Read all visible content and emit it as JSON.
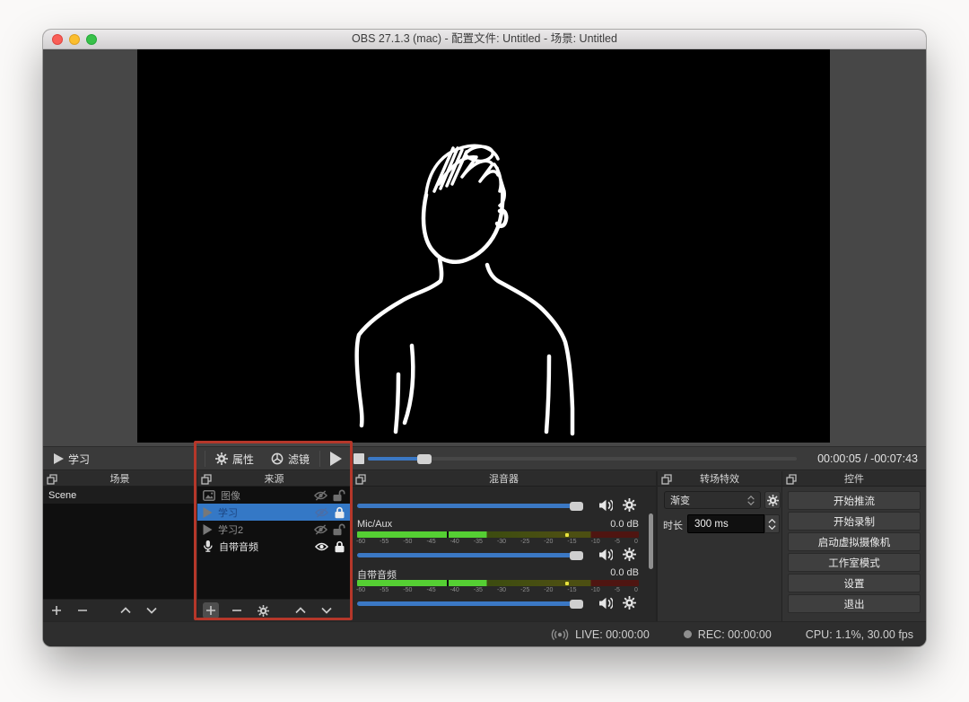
{
  "window": {
    "title": "OBS 27.1.3 (mac) - 配置文件: Untitled - 场景: Untitled"
  },
  "media_toolbar": {
    "source_name": "学习",
    "properties_label": "属性",
    "filters_label": "滤镜",
    "time": "00:00:05 / -00:07:43"
  },
  "scenes": {
    "title": "场景",
    "rows": [
      {
        "label": "Scene"
      }
    ]
  },
  "sources": {
    "title": "来源",
    "rows": [
      {
        "label": "图像"
      },
      {
        "label": "学习"
      },
      {
        "label": "学习2"
      },
      {
        "label": "自带音频"
      }
    ]
  },
  "mixer": {
    "title": "混音器",
    "channels": [
      {
        "name": "Mic/Aux",
        "level": "0.0 dB"
      },
      {
        "name": "自带音频",
        "level": "0.0 dB"
      }
    ],
    "scale_ticks": [
      "-60",
      "-55",
      "-50",
      "-45",
      "-40",
      "-35",
      "-30",
      "-25",
      "-20",
      "-15",
      "-10",
      "-5",
      "0"
    ]
  },
  "transitions": {
    "title": "转场特效",
    "selected_transition": "渐变",
    "duration_label": "时长",
    "duration_value": "300 ms"
  },
  "controls": {
    "title": "控件",
    "buttons": {
      "stream": "开始推流",
      "record": "开始录制",
      "virtual_cam": "启动虚拟摄像机",
      "studio_mode": "工作室模式",
      "settings": "设置",
      "exit": "退出"
    }
  },
  "status_bar": {
    "live": "LIVE: 00:00:00",
    "rec": "REC: 00:00:00",
    "cpu": "CPU: 1.1%, 30.00 fps"
  },
  "colors": {
    "accent_blue": "#3b78c4",
    "selection_blue": "#3478c6",
    "annotation_red": "#b5372a"
  }
}
